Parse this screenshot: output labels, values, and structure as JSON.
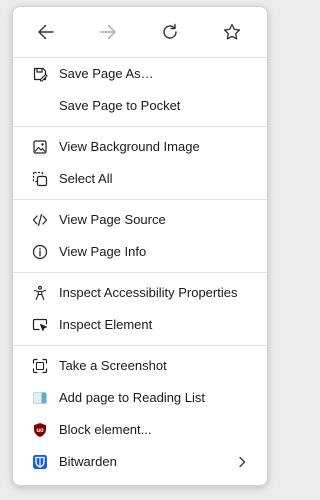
{
  "nav": {
    "back_icon": "arrow-left-icon",
    "forward_icon": "arrow-right-icon",
    "reload_icon": "reload-icon",
    "bookmark_icon": "star-icon"
  },
  "menu": {
    "items": [
      {
        "label": "Save Page As…",
        "icon": "save-icon"
      },
      {
        "label": "Save Page to Pocket",
        "icon": ""
      },
      {
        "label": "View Background Image",
        "icon": "image-icon"
      },
      {
        "label": "Select All",
        "icon": "select-all-icon"
      },
      {
        "label": "View Page Source",
        "icon": "code-icon"
      },
      {
        "label": "View Page Info",
        "icon": "info-icon"
      },
      {
        "label": "Inspect Accessibility Properties",
        "icon": "accessibility-icon"
      },
      {
        "label": "Inspect Element",
        "icon": "inspect-icon"
      },
      {
        "label": "Take a Screenshot",
        "icon": "screenshot-icon"
      },
      {
        "label": "Add page to Reading List",
        "icon": "reading-list-icon"
      },
      {
        "label": "Block element...",
        "icon": "ublock-icon"
      },
      {
        "label": "Bitwarden",
        "icon": "bitwarden-icon"
      }
    ]
  },
  "colors": {
    "ublock": "#800000",
    "bitwarden": "#175ddc",
    "reading_list": "#5ab0c8",
    "disabled": "#a8a8a8"
  }
}
